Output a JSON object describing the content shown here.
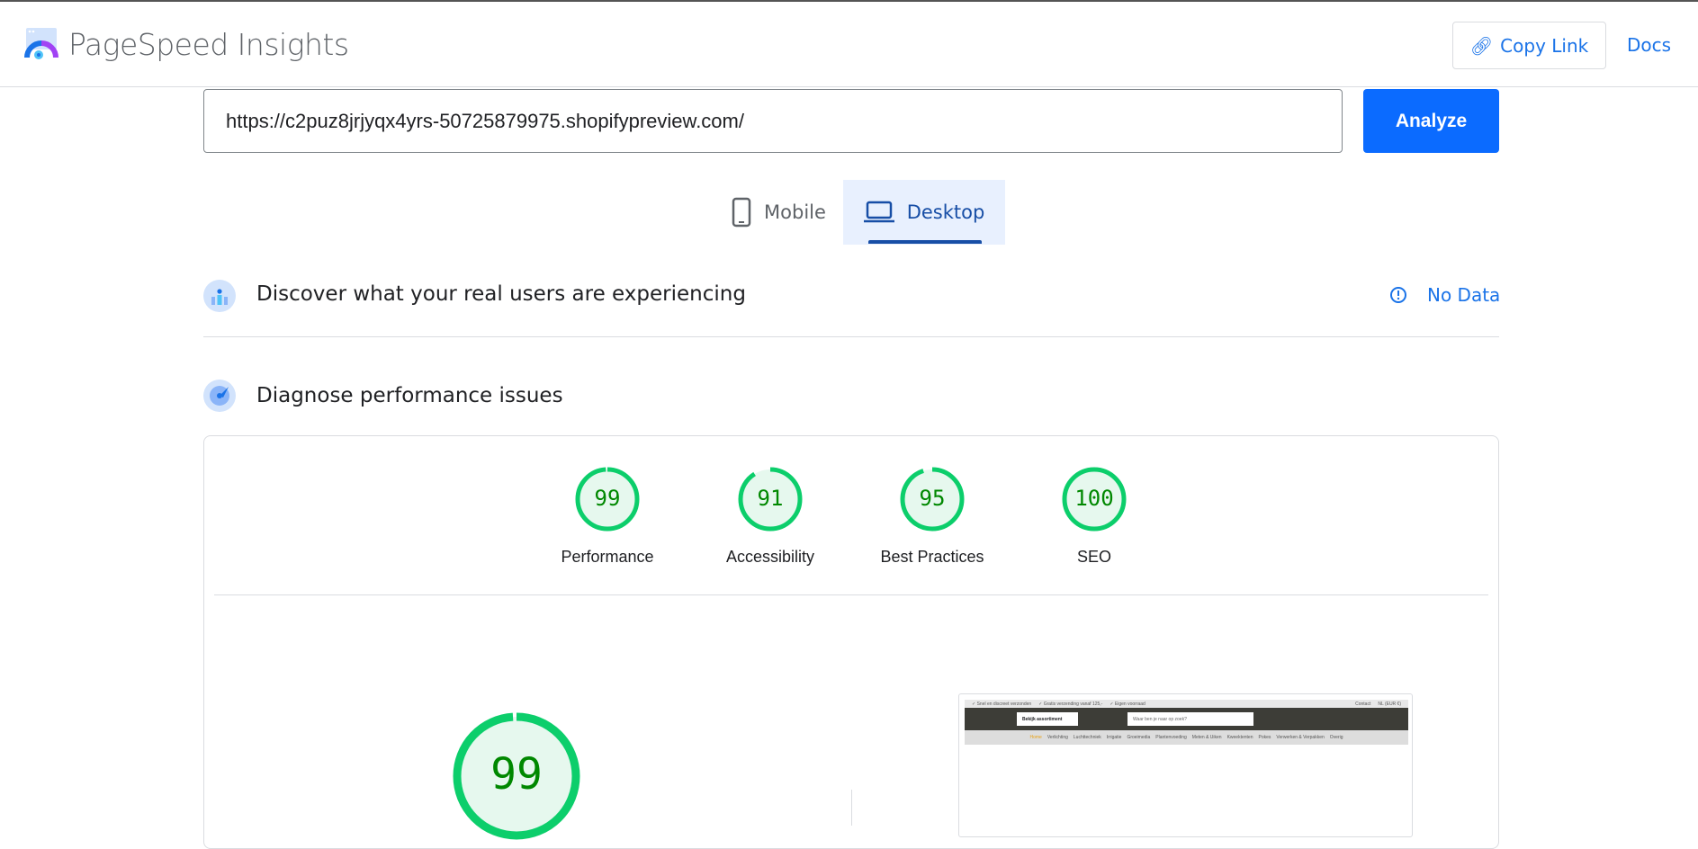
{
  "header": {
    "title": "PageSpeed Insights",
    "copy_link": "Copy Link",
    "docs": "Docs"
  },
  "search": {
    "url": "https://c2puz8jrjyqx4yrs-50725879975.shopifypreview.com/",
    "analyze": "Analyze"
  },
  "tabs": [
    {
      "label": "Mobile",
      "icon": "phone-icon"
    },
    {
      "label": "Desktop",
      "icon": "laptop-icon",
      "selected": true
    }
  ],
  "field_data": {
    "title": "Discover what your real users are experiencing",
    "status": "No Data"
  },
  "lab": {
    "title": "Diagnose performance issues"
  },
  "scores": [
    {
      "label": "Performance",
      "value": 99
    },
    {
      "label": "Accessibility",
      "value": 91
    },
    {
      "label": "Best Practices",
      "value": 95
    },
    {
      "label": "SEO",
      "value": 100
    }
  ],
  "main_score": {
    "value": 99
  },
  "colors": {
    "pass": "#0cce6b",
    "pass_text": "#008800",
    "accent": "#1a73e8",
    "button": "#0b6bff"
  },
  "thumbnail": {
    "topbar": [
      "✓ Snel en discreet verzonden",
      "✓ Gratis verzending vanaf 125,-",
      "✓ Eigen voorraad"
    ],
    "topbar_right": [
      "Contact",
      "NL (EUR €)"
    ],
    "menu_button": "Bekijk assortiment",
    "search_placeholder": "Waar ben je naar op zoek?",
    "nav": [
      "Home",
      "Verlichting",
      "Luchttechniek",
      "Irrigatie",
      "Groeimedia",
      "Plantenvoeding",
      "Meten & Uiken",
      "Kweektenten",
      "Pokes",
      "Verwerken & Verpakken",
      "Overig"
    ]
  }
}
